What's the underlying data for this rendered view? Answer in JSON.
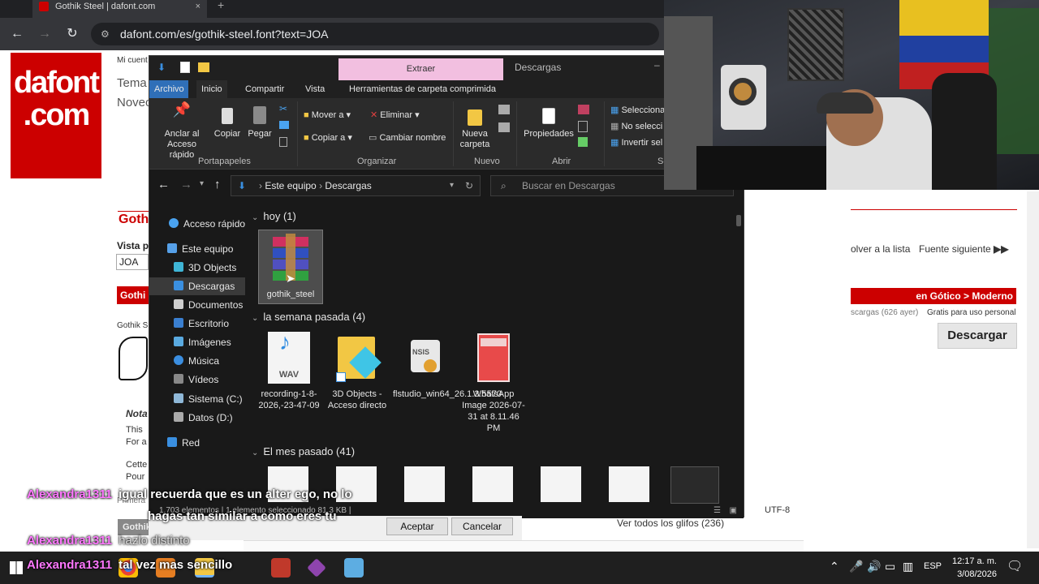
{
  "browser": {
    "tab_title": "Gothik Steel | dafont.com",
    "url": "dafont.com/es/gothik-steel.font?text=JOA",
    "tab_close": "×",
    "new_tab": "+"
  },
  "dafont": {
    "logo_line1": "dafont",
    "logo_line2": ".com",
    "mi_cuenta": "Mi cuent",
    "tema": "Tema",
    "novedades": "Noveo",
    "font_title": "Gothi",
    "vista_previa": "Vista p",
    "preview_text": "JOA",
    "category_short": "Gothi",
    "gothik_small": "Gothik S",
    "nota": "Nota",
    "this": "This",
    "for_a": "For a",
    "cette": "Cette",
    "pour": "Pour",
    "primera": "Primera",
    "volver": "olver a la lista",
    "fuente_siguiente": "Fuente siguiente",
    "category": "en Gótico > Moderno",
    "descargas_count": "scargas (626 ayer)",
    "gratis": "Gratis para uso personal",
    "descargar": "Descargar",
    "ver_glifos": "Ver todos los glifos (236)",
    "encoding": "UTF-8",
    "gothik_steel_footer": "Gothik Steel.ttf"
  },
  "explorer": {
    "context_tab": "Extraer",
    "window_title": "Descargas",
    "ribbon_tabs": [
      "Archivo",
      "Inicio",
      "Compartir",
      "Vista",
      "Herramientas de carpeta comprimida"
    ],
    "clipboard": {
      "anclar": "Anclar al",
      "anclar2": "Acceso rápido",
      "copiar": "Copiar",
      "pegar": "Pegar",
      "group": "Portapapeles"
    },
    "organize": {
      "mover": "Mover a",
      "copiar_a": "Copiar a",
      "eliminar": "Eliminar",
      "cambiar": "Cambiar nombre",
      "group": "Organizar"
    },
    "nuevo": {
      "nueva": "Nueva",
      "carpeta": "carpeta",
      "group": "Nuevo"
    },
    "abrir": {
      "propiedades": "Propiedades",
      "group": "Abrir"
    },
    "select": {
      "seleccionar": "Selecciona",
      "no_sel": "No selecci",
      "invertir": "Invertir sel",
      "group": "Seleccio"
    },
    "breadcrumb": {
      "equipo": "Este equipo",
      "descargas": "Descargas"
    },
    "search_placeholder": "Buscar en Descargas",
    "sidebar": [
      {
        "label": "Acceso rápido",
        "color": "#4aa3f0"
      },
      {
        "label": "Este equipo",
        "color": "#56a0e8"
      },
      {
        "label": "3D Objects",
        "color": "#3fb5d6"
      },
      {
        "label": "Descargas",
        "color": "#3a8fe0"
      },
      {
        "label": "Documentos",
        "color": "#cfcfcf"
      },
      {
        "label": "Escritorio",
        "color": "#3a7fd0"
      },
      {
        "label": "Imágenes",
        "color": "#5aaae0"
      },
      {
        "label": "Música",
        "color": "#3b8ee0"
      },
      {
        "label": "Vídeos",
        "color": "#888"
      },
      {
        "label": "Sistema (C:)",
        "color": "#8fb8d8"
      },
      {
        "label": "Datos (D:)",
        "color": "#aaa"
      },
      {
        "label": "Red",
        "color": "#3a8fe0"
      }
    ],
    "groups": {
      "hoy": "hoy (1)",
      "semana": "la semana pasada (4)",
      "mes": "El mes pasado (41)"
    },
    "files_today": [
      {
        "name": "gothik_steel"
      }
    ],
    "files_week": [
      {
        "name": "recording-1-8-2026,-23-47-09",
        "icon": "wav"
      },
      {
        "name": "3D Objects - Acceso directo",
        "icon": "folder"
      },
      {
        "name": "flstudio_win64_26.1.3.5570",
        "icon": "nsis"
      },
      {
        "name": "WhatsApp Image 2026-07-31 at 8.11.46 PM",
        "icon": "image"
      }
    ],
    "wav_label": "WAV",
    "nsis_label": "NSIS",
    "status": "1.703 elementos  |  1 elemento seleccionado  81,3 KB  |"
  },
  "dialog": {
    "aceptar": "Aceptar",
    "cancelar": "Cancelar"
  },
  "chat": [
    {
      "user": "Alexandra1311",
      "msg": "igual recuerda que es un alter ego, no lo"
    },
    {
      "user": "",
      "msg": "hagas tan similar a como eres tu"
    },
    {
      "user": "Alexandra1311",
      "msg": "hazlo distinto"
    },
    {
      "user": "Alexandra1311",
      "msg": "tal vez mas sencillo"
    }
  ],
  "taskbar": {
    "lang": "ESP",
    "time": "12:17 a. m.",
    "date": "3/08/2026"
  },
  "colors": {
    "accent_red": "#cc0000",
    "explorer_bg": "#191919",
    "extract_tab": "#f2bfe0",
    "chat_user": "#ff77ff"
  }
}
